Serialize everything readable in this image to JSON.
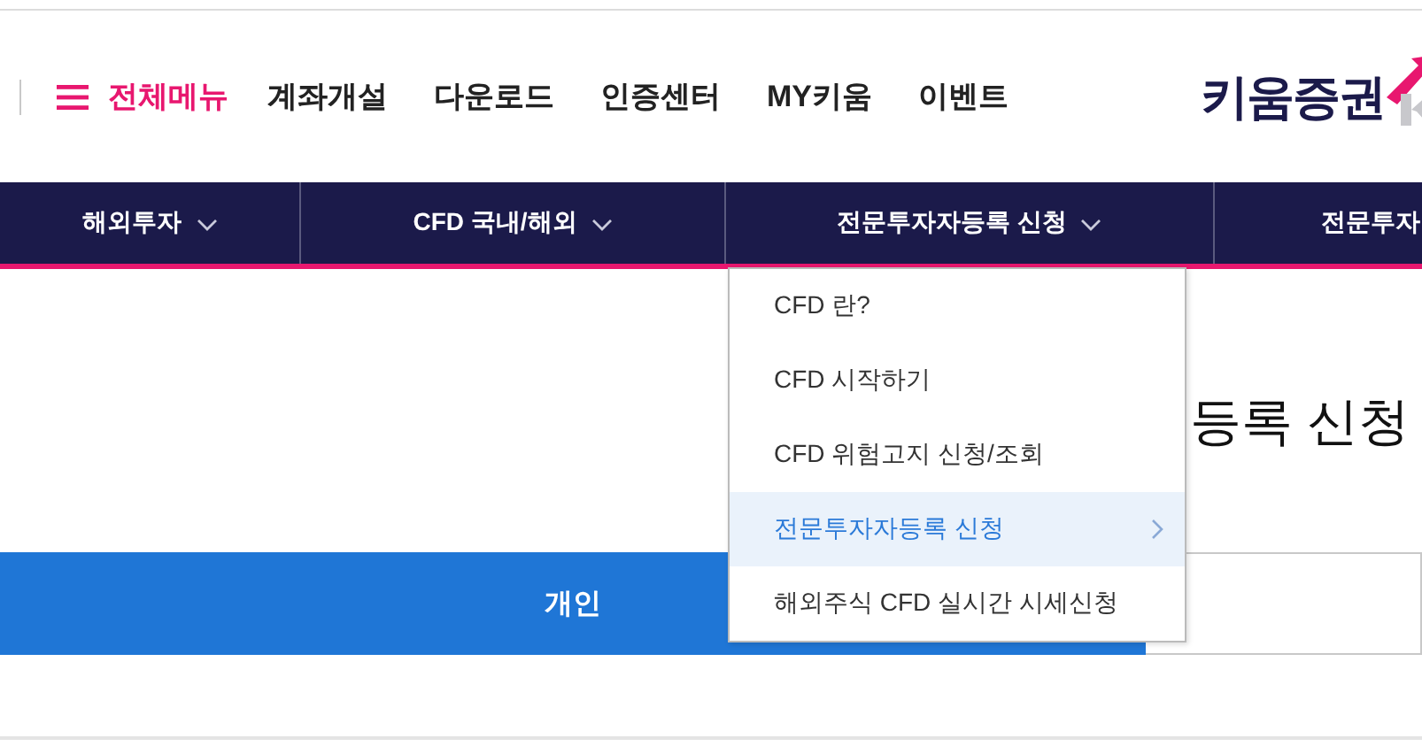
{
  "header": {
    "all_menu": "전체메뉴",
    "links": [
      "계좌개설",
      "다운로드",
      "인증센터",
      "MY키움",
      "이벤트"
    ],
    "logo": "키움증권"
  },
  "nav": [
    {
      "label": "해외투자"
    },
    {
      "label": "CFD 국내/해외"
    },
    {
      "label": "전문투자자등록 신청"
    },
    {
      "label": "전문투자"
    }
  ],
  "dropdown": [
    {
      "label": "CFD 란?",
      "selected": false
    },
    {
      "label": "CFD 시작하기",
      "selected": false
    },
    {
      "label": "CFD 위험고지 신청/조회",
      "selected": false
    },
    {
      "label": "전문투자자등록 신청",
      "selected": true
    },
    {
      "label": "해외주식 CFD 실시간 시세신청",
      "selected": false
    }
  ],
  "page_title": "등록 신청",
  "tabs": [
    {
      "label": "개인",
      "selected": true
    },
    {
      "selected": false
    }
  ]
}
